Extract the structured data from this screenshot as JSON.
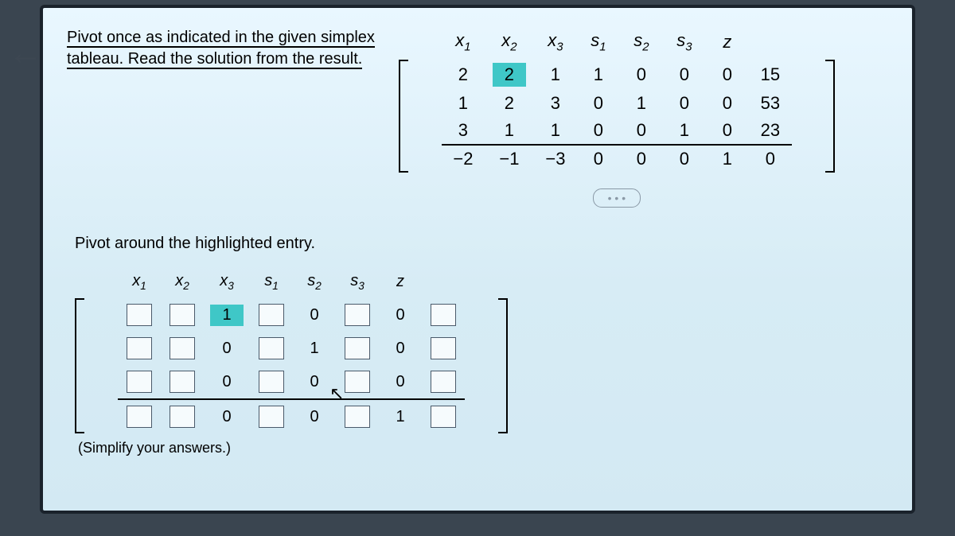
{
  "prompt": {
    "line1": "Pivot once as indicated in the given simplex",
    "line2": "tableau. Read the solution from the result."
  },
  "header": {
    "x1_base": "x",
    "x1_sub": "1",
    "x2_base": "x",
    "x2_sub": "2",
    "x3_base": "x",
    "x3_sub": "3",
    "s1_base": "s",
    "s1_sub": "1",
    "s2_base": "s",
    "s2_sub": "2",
    "s3_base": "s",
    "s3_sub": "3",
    "z": "z"
  },
  "tab": {
    "r0": {
      "x1": "2",
      "x2": "2",
      "x3": "1",
      "s1": "1",
      "s2": "0",
      "s3": "0",
      "z": "0",
      "rhs": "15"
    },
    "r1": {
      "x1": "1",
      "x2": "2",
      "x3": "3",
      "s1": "0",
      "s2": "1",
      "s3": "0",
      "z": "0",
      "rhs": "53"
    },
    "r2": {
      "x1": "3",
      "x2": "1",
      "x3": "1",
      "s1": "0",
      "s2": "0",
      "s3": "1",
      "z": "0",
      "rhs": "23"
    },
    "r3": {
      "x1": "−2",
      "x2": "−1",
      "x3": "−3",
      "s1": "0",
      "s2": "0",
      "s3": "0",
      "z": "1",
      "rhs": "0"
    }
  },
  "expand": "• • •",
  "section2_title": "Pivot around the highlighted entry.",
  "ans": {
    "r0": {
      "x3": "1",
      "s2": "0",
      "z": "0"
    },
    "r1": {
      "x3": "0",
      "s2": "1",
      "z": "0"
    },
    "r2": {
      "x3": "0",
      "s2": "0",
      "z": "0"
    },
    "r3": {
      "x3": "0",
      "s2": "0",
      "z": "1"
    }
  },
  "hint": "(Simplify your answers.)"
}
